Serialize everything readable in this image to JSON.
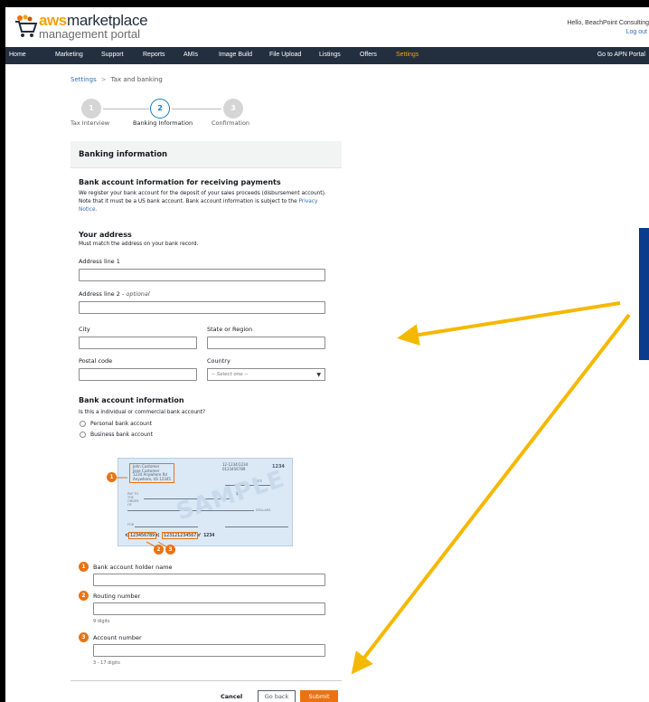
{
  "brand": {
    "aws": "aws",
    "marketplace": "marketplace",
    "management": "management portal"
  },
  "user": {
    "greeting": "Hello, BeachPoint Consulting",
    "logout": "Log out"
  },
  "nav": {
    "items": [
      "Home",
      "Marketing",
      "Support",
      "Reports",
      "AMIs",
      "Image Build",
      "File Upload",
      "Listings",
      "Offers",
      "Settings"
    ],
    "active": "Settings",
    "right": "Go to APN Portal"
  },
  "breadcrumb": {
    "parent": "Settings",
    "separator": ">",
    "current": "Tax and banking"
  },
  "stepper": [
    {
      "number": "1",
      "label": "Tax Interview"
    },
    {
      "number": "2",
      "label": "Banking Information"
    },
    {
      "number": "3",
      "label": "Confirmation"
    }
  ],
  "form": {
    "panel_title": "Banking information",
    "receiving": {
      "heading": "Bank account information for receiving payments",
      "body": "We register your bank account for the deposit of your sales proceeds (disbursement account). Note that it must be a US bank account. Bank account information is subject to the",
      "link": "Privacy Notice."
    },
    "address": {
      "heading": "Your address",
      "subtitle": "Must match the address on your bank record.",
      "line1_label": "Address line 1",
      "line2_label": "Address line 2 - ",
      "line2_optional": "optional",
      "city_label": "City",
      "state_label": "State or Region",
      "postal_label": "Postal code",
      "country_label": "Country",
      "country_placeholder": "-- Select one --"
    },
    "bank": {
      "heading": "Bank account information",
      "question": "Is this a individual or commercial bank account?",
      "options": [
        "Personal bank account",
        "Business bank account"
      ],
      "holder_label": "Bank account holder name",
      "routing_label": "Routing number",
      "routing_hint": "9 digits",
      "account_label": "Account number",
      "account_hint": "3 - 17 digits"
    },
    "check": {
      "name_lines": [
        "John Customer",
        "Jane Customer",
        "1234 Anywhere Rd",
        "Anywhere, US 12345"
      ],
      "top_right": [
        "12-1234/1234",
        "0123456789"
      ],
      "check_no": "1234",
      "watermark": "SAMPLE",
      "micr_routing": "123456789",
      "micr_account": "123121234567",
      "micr_end": "1234",
      "date_label": "DATE",
      "dollar_sign": "$",
      "dollars_label": "DOLLARS",
      "pay_label": "PAY TO THE ORDER OF",
      "for_label": "FOR"
    },
    "badges": [
      "1",
      "2",
      "3"
    ],
    "buttons": {
      "cancel": "Cancel",
      "back": "Go back",
      "submit": "Submit"
    }
  },
  "colors": {
    "nav_bg": "#232f3e",
    "accent": "#ec7211",
    "active_nav": "#f0a30a",
    "link": "#2f6eb5",
    "arrow": "#f5b800"
  }
}
